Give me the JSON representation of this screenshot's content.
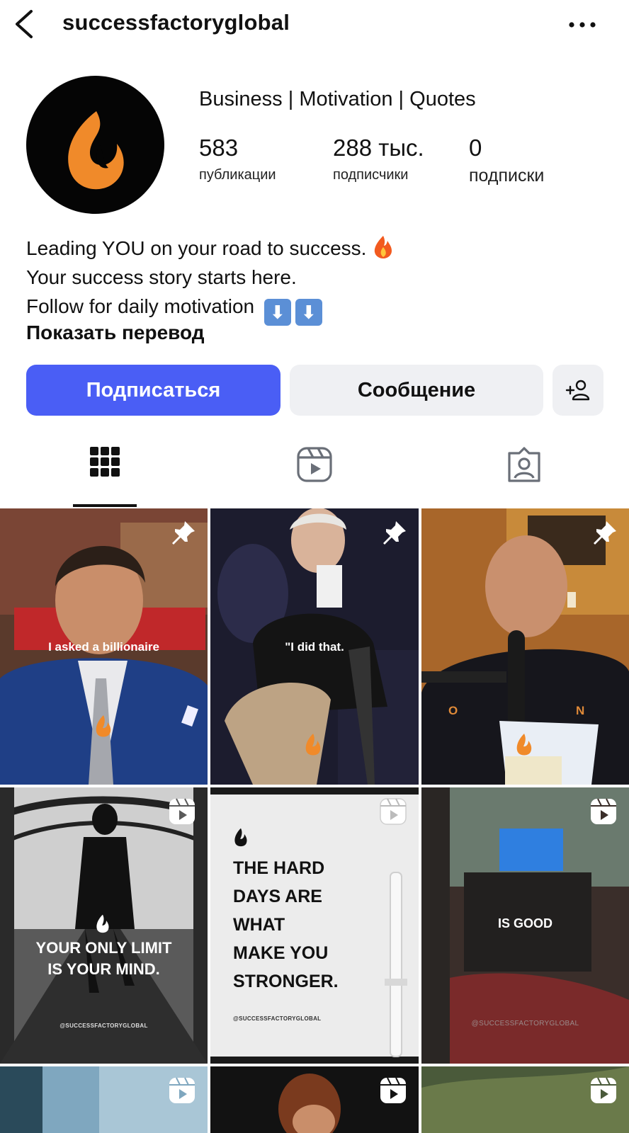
{
  "header": {
    "username": "successfactoryglobal"
  },
  "profile": {
    "display_name": "Business | Motivation | Quotes",
    "stats": [
      {
        "value": "583",
        "label": "публикации"
      },
      {
        "value": "288 тыс.",
        "label": "подписчики"
      },
      {
        "value": "0",
        "label": "подписки"
      }
    ],
    "bio": [
      "Leading YOU on your road to success.",
      "Your success story starts here.",
      "Follow for daily motivation"
    ],
    "bio_arrows": [
      "⬇",
      "⬇"
    ],
    "translate_label": "Показать перевод"
  },
  "actions": {
    "follow_label": "Подписаться",
    "message_label": "Сообщение"
  },
  "tabs": [
    "grid-icon",
    "reels-icon",
    "tagged-icon"
  ],
  "grid": {
    "posts": [
      {
        "caption": "I asked a billionaire",
        "badge": "pin"
      },
      {
        "caption": "\"I did that.",
        "badge": "pin"
      },
      {
        "caption": "",
        "badge": "pin",
        "shirt_letters": [
          "O",
          "N"
        ]
      },
      {
        "caption": "YOUR ONLY LIMIT\nIS YOUR MIND.",
        "badge": "reel",
        "watermark": "@SUCCESSFACTORYGLOBAL"
      },
      {
        "caption": "THE HARD\nDAYS ARE\nWHAT\nMAKE YOU\nSTRONGER.",
        "badge": "reel",
        "watermark": "@SUCCESSFACTORYGLOBAL"
      },
      {
        "caption": "IS GOOD",
        "badge": "reel",
        "watermark": "@SUCCESSFACTORYGLOBAL"
      },
      {
        "caption": "",
        "badge": "reel"
      },
      {
        "caption": "",
        "badge": "reel"
      },
      {
        "caption": "",
        "badge": "reel"
      }
    ]
  },
  "colors": {
    "accent": "#4a5ef5",
    "secondary_button": "#eff0f3",
    "flame": "#f08a2a"
  }
}
